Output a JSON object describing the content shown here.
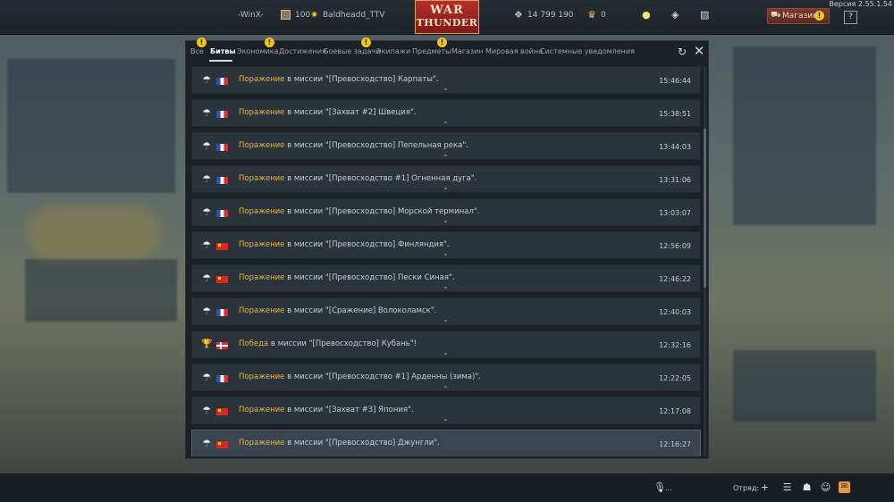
{
  "version": "Версия 2.55.1.54",
  "topbar": {
    "player_left": "-WinX-",
    "level": "100",
    "player_name": "Baldheadd_TTV",
    "logo_line1": "WAR",
    "logo_line2": "THUNDER",
    "silver_lions": "14 799 190",
    "golden_eagles": "0",
    "shop_label": "Магазин",
    "help_label": "?"
  },
  "tabs": [
    {
      "label": "Все"
    },
    {
      "label": "Битвы"
    },
    {
      "label": "Экономика"
    },
    {
      "label": "Достижения"
    },
    {
      "label": "Боевые задачи"
    },
    {
      "label": "Экипажи"
    },
    {
      "label": "Предметы"
    },
    {
      "label": "Магазин"
    },
    {
      "label": "Мировая война"
    },
    {
      "label": "Системные уведомления"
    }
  ],
  "icons": {
    "refresh": "refresh-icon",
    "close": "close-icon",
    "defeat": "parachute-icon",
    "victory": "trophy-icon",
    "chevron": "chevron-down-icon"
  },
  "colors": {
    "accent_gold": "#e0b84a",
    "warning": "#f0c419",
    "panel_bg": "#1b2127",
    "row_bg": "#2b333b"
  },
  "messages": [
    {
      "result": "Поражение",
      "mission": " в миссии \"[Превосходство] Карпаты\".",
      "time": "15:46:44",
      "flag": "fr"
    },
    {
      "result": "Поражение",
      "mission": " в миссии \"[Захват #2] Швеция\".",
      "time": "15:38:51",
      "flag": "fr"
    },
    {
      "result": "Поражение",
      "mission": " в миссии \"[Превосходство] Пепельная река\".",
      "time": "13:44:03",
      "flag": "fr"
    },
    {
      "result": "Поражение",
      "mission": " в миссии \"[Превосходство #1] Огненная дуга\".",
      "time": "13:31:06",
      "flag": "fr"
    },
    {
      "result": "Поражение",
      "mission": " в миссии \"[Превосходство] Морской терминал\".",
      "time": "13:03:07",
      "flag": "fr"
    },
    {
      "result": "Поражение",
      "mission": " в миссии \"[Превосходство] Финляндия\".",
      "time": "12:56:09",
      "flag": "cn"
    },
    {
      "result": "Поражение",
      "mission": " в миссии \"[Превосходство] Пески Синая\".",
      "time": "12:46:22",
      "flag": "cn"
    },
    {
      "result": "Поражение",
      "mission": " в миссии \"[Сражение] Волоколамск\".",
      "time": "12:40:03",
      "flag": "fr"
    },
    {
      "result": "Победа",
      "mission": " в миссии \"[Превосходство] Кубань\"!",
      "time": "12:32:16",
      "flag": "no"
    },
    {
      "result": "Поражение",
      "mission": " в миссии \"[Превосходство #1] Арденны (зима)\".",
      "time": "12:22:05",
      "flag": "fr"
    },
    {
      "result": "Поражение",
      "mission": " в миссии \"[Захват #3] Япония\".",
      "time": "12:17:08",
      "flag": "cn"
    },
    {
      "result": "Поражение",
      "mission": " в миссии \"[Превосходство] Джунгли\".",
      "time": "12:16:27",
      "flag": "cn"
    }
  ],
  "bottombar": {
    "voice_label": "...",
    "squad_label": "Отряд:"
  }
}
